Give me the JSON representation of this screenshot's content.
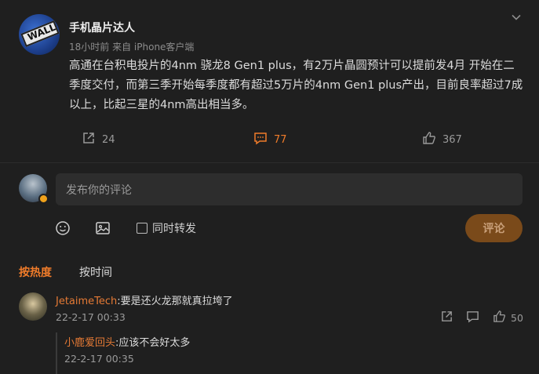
{
  "post": {
    "author": "手机晶片达人",
    "time": "18小时前",
    "source": "来自 iPhone客户端",
    "avatar_text": "WALL",
    "content": "高通在台积电投片的4nm 骁龙8 Gen1 plus，有2万片晶圆预计可以提前发4月 开始在二季度交付，而第三季开始每季度都有超过5万片的4nm Gen1 plus产出，目前良率超过7成以上，比起三星的4nm高出相当多。",
    "share_count": "24",
    "comment_count": "77",
    "like_count": "367"
  },
  "composer": {
    "placeholder": "发布你的评论",
    "repost_label": "同时转发",
    "submit_label": "评论"
  },
  "sort": {
    "hot": "按热度",
    "time": "按时间"
  },
  "comments": [
    {
      "user": "JetaimeTech",
      "text": ":要是还火龙那就真拉垮了",
      "time": "22-2-17 00:33",
      "like_count": "50",
      "replies": [
        {
          "user": "小鹿爱回头",
          "text": ":应该不会好太多",
          "time": "22-2-17 00:35"
        }
      ]
    }
  ],
  "colors": {
    "accent": "#f07c2a",
    "background": "#1f1f1f",
    "submit_bg": "#7a4a1a"
  },
  "icons": {
    "share": "share-icon",
    "comment": "comment-icon",
    "like": "thumbs-up-icon",
    "emoji": "emoji-icon",
    "image": "image-icon",
    "more": "chevron-down-icon"
  }
}
